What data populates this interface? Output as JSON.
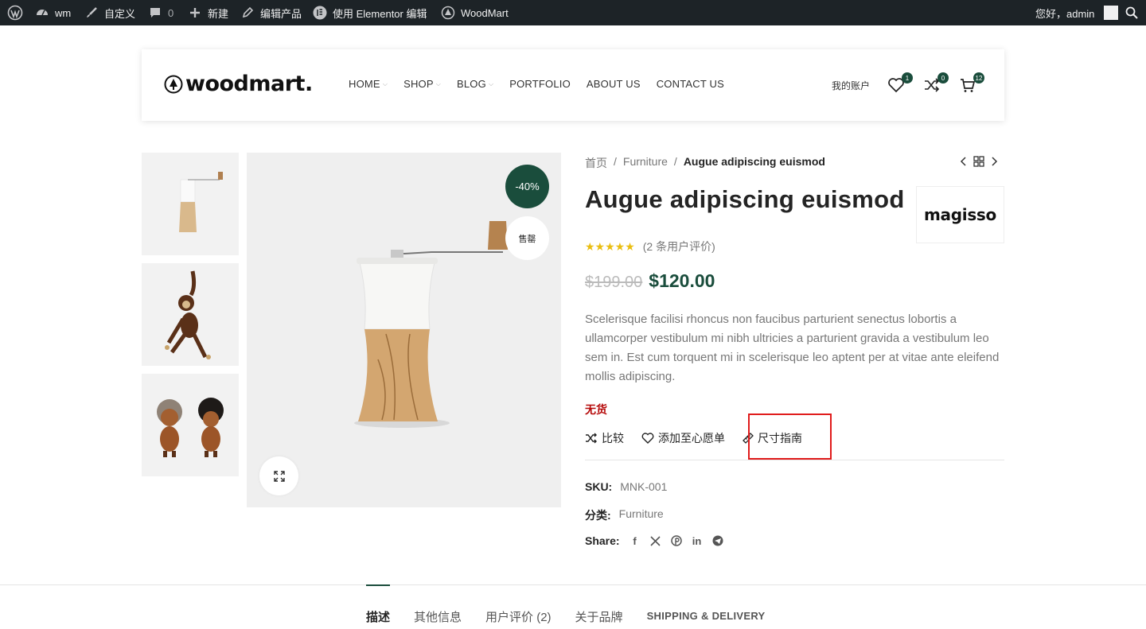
{
  "admin_bar": {
    "site_name": "wm",
    "customize": "自定义",
    "comments_count": "0",
    "new": "新建",
    "edit_product": "编辑产品",
    "elementor": "使用 Elementor 编辑",
    "woodmart": "WoodMart",
    "greeting": "您好，admin"
  },
  "header": {
    "logo": "woodmart.",
    "nav": [
      "HOME",
      "SHOP",
      "BLOG",
      "PORTFOLIO",
      "ABOUT US",
      "CONTACT US"
    ],
    "account": "我的账户",
    "wishlist_count": "1",
    "compare_count": "0",
    "cart_count": "12"
  },
  "gallery": {
    "sale_badge": "-40%",
    "soldout_badge": "售罄"
  },
  "product": {
    "breadcrumb": [
      "首页",
      "Furniture",
      "Augue adipiscing euismod"
    ],
    "title": "Augue adipiscing euismod",
    "brand": "magisso",
    "stars": "★★★★★",
    "rating_value": 5,
    "reviews_text": "(2 条用户评价)",
    "old_price": "$199.00",
    "price": "$120.00",
    "description": "Scelerisque facilisi rhoncus non faucibus parturient senectus lobortis a ullamcorper vestibulum mi nibh ultricies a parturient gravida a vestibulum leo sem in. Est cum torquent mi in scelerisque leo aptent per at vitae ante eleifend mollis adipiscing.",
    "stock": "无货",
    "compare": "比较",
    "wishlist": "添加至心愿单",
    "size_guide": "尺寸指南",
    "sku_label": "SKU:",
    "sku": "MNK-001",
    "category_label": "分类:",
    "category": "Furniture",
    "share_label": "Share:"
  },
  "tabs": [
    "描述",
    "其他信息",
    "用户评价 (2)",
    "关于品牌",
    "Shipping & Delivery"
  ],
  "colors": {
    "accent": "#1a4d3c",
    "out_of_stock": "#b50808",
    "highlight_box": "#e01b1b",
    "admin_bar": "#1d2327"
  }
}
